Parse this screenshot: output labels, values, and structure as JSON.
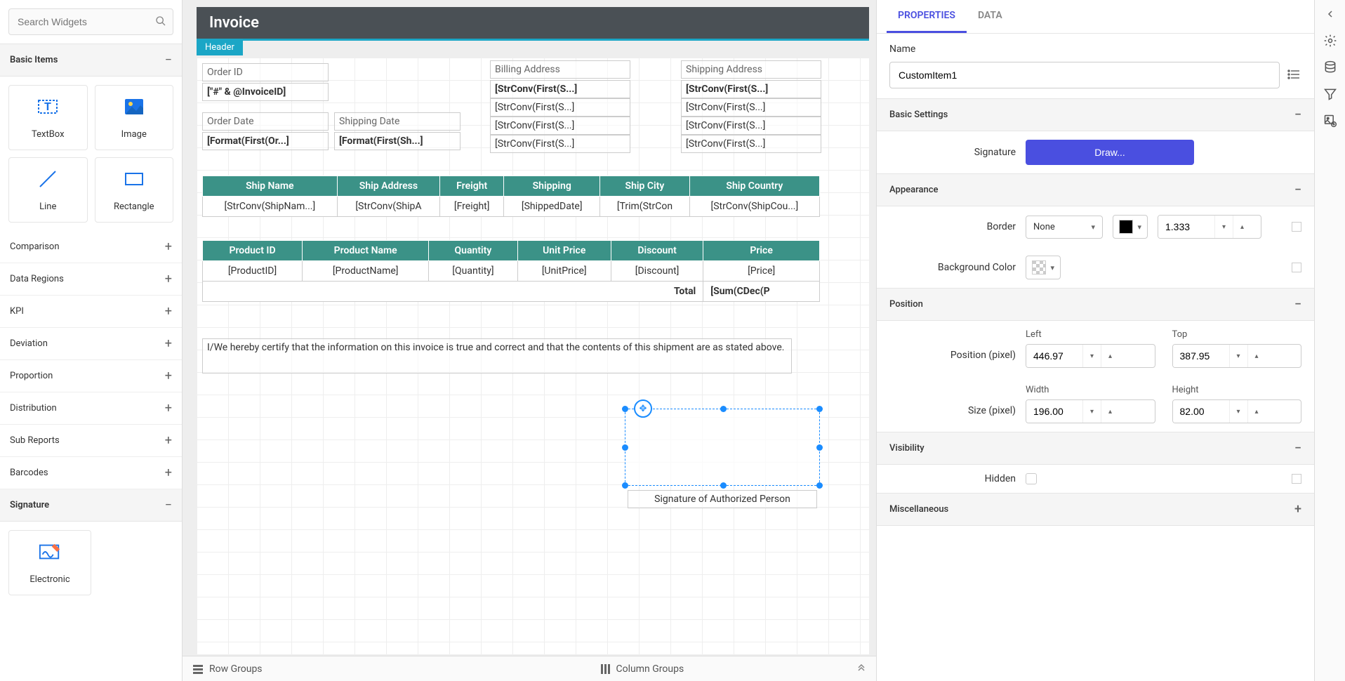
{
  "search": {
    "placeholder": "Search Widgets"
  },
  "sections": {
    "basic": {
      "title": "Basic Items",
      "items": [
        "TextBox",
        "Image",
        "Line",
        "Rectangle"
      ]
    },
    "categories": [
      "Comparison",
      "Data Regions",
      "KPI",
      "Deviation",
      "Proportion",
      "Distribution",
      "Sub Reports",
      "Barcodes"
    ],
    "signature": {
      "title": "Signature",
      "item": "Electronic"
    }
  },
  "canvas": {
    "title": "Invoice",
    "header_tag": "Header",
    "fields": {
      "order_id_label": "Order ID",
      "order_id_val": "[\"#\" & @InvoiceID]",
      "order_date_label": "Order Date",
      "order_date_val": "[Format(First(Or...]",
      "ship_date_label": "Shipping Date",
      "ship_date_val": "[Format(First(Sh...]",
      "billing_label": "Billing Address",
      "billing1": "[StrConv(First(S...]",
      "billing2": "[StrConv(First(S...]",
      "billing3": "[StrConv(First(S...]",
      "billing4": "[StrConv(First(S...]",
      "shipping_label": "Shipping Address",
      "shipping1": "[StrConv(First(S...]",
      "shipping2": "[StrConv(First(S...]",
      "shipping3": "[StrConv(First(S...]",
      "shipping4": "[StrConv(First(S...]"
    },
    "table1": {
      "headers": [
        "Ship Name",
        "Ship Address",
        "Freight",
        "Shipping",
        "Ship City",
        "Ship Country"
      ],
      "row": [
        "[StrConv(ShipNam...]",
        "[StrConv(ShipA",
        "[Freight]",
        "[ShippedDate]",
        "[Trim(StrCon",
        "[StrConv(ShipCou...]"
      ]
    },
    "table2": {
      "headers": [
        "Product ID",
        "Product Name",
        "Quantity",
        "Unit Price",
        "Discount",
        "Price"
      ],
      "row": [
        "[ProductID]",
        "[ProductName]",
        "[Quantity]",
        "[UnitPrice]",
        "[Discount]",
        "[Price]"
      ],
      "total_label": "Total",
      "total_val": "[Sum(CDec(P"
    },
    "certify": "I/We hereby certify that the information on this invoice is true and correct and that the contents of this shipment are as stated above.",
    "sig_label": "Signature of Authorized Person",
    "row_groups": "Row Groups",
    "col_groups": "Column Groups"
  },
  "props": {
    "tabs": [
      "PROPERTIES",
      "DATA"
    ],
    "name_label": "Name",
    "name_value": "CustomItem1",
    "basic": {
      "title": "Basic Settings",
      "signature_label": "Signature",
      "draw": "Draw..."
    },
    "appearance": {
      "title": "Appearance",
      "border_label": "Border",
      "border_value": "None",
      "border_width": "1.333",
      "bg_label": "Background Color"
    },
    "position": {
      "title": "Position",
      "pos_label": "Position (pixel)",
      "size_label": "Size (pixel)",
      "left_label": "Left",
      "left": "446.97",
      "top_label": "Top",
      "top": "387.95",
      "width_label": "Width",
      "width": "196.00",
      "height_label": "Height",
      "height": "82.00"
    },
    "visibility": {
      "title": "Visibility",
      "hidden_label": "Hidden"
    },
    "misc": {
      "title": "Miscellaneous"
    }
  }
}
